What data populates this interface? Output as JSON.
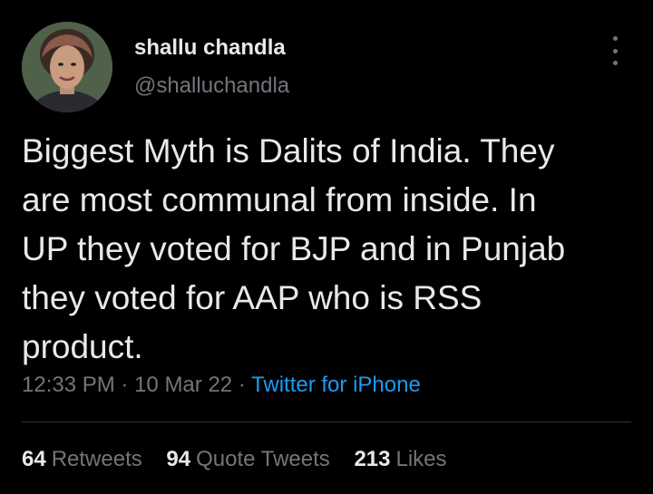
{
  "user": {
    "display_name": "shallu chandla",
    "handle": "@shalluchandla"
  },
  "tweet": {
    "text": "Biggest Myth is Dalits of India. They\nare most communal from inside. In\nUP they voted for BJP and in Punjab\nthey voted for AAP who is RSS\nproduct.",
    "time": "12:33 PM",
    "date": "10 Mar 22",
    "sep": "·",
    "source": "Twitter for iPhone"
  },
  "stats": {
    "retweets_count": "64",
    "retweets_label": "Retweets",
    "quotes_count": "94",
    "quotes_label": "Quote Tweets",
    "likes_count": "213",
    "likes_label": "Likes"
  },
  "icons": {
    "more": "more-vertical-icon"
  },
  "colors": {
    "background": "#000000",
    "primary_text": "#e7e9ea",
    "secondary_text": "#71767b",
    "link": "#1d9bf0",
    "divider": "#2f3336"
  }
}
